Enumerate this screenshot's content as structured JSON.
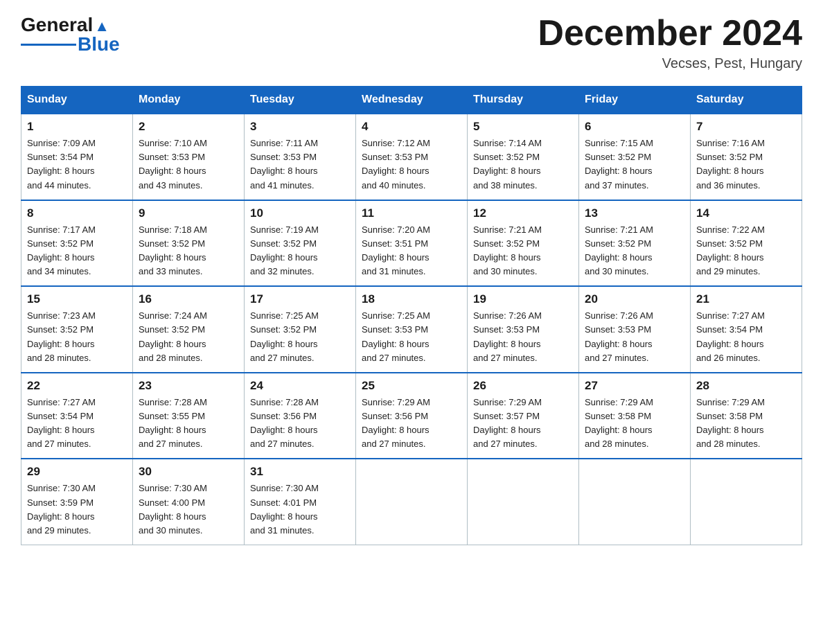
{
  "header": {
    "logo_general": "General",
    "logo_blue": "Blue",
    "month_title": "December 2024",
    "location": "Vecses, Pest, Hungary"
  },
  "weekdays": [
    "Sunday",
    "Monday",
    "Tuesday",
    "Wednesday",
    "Thursday",
    "Friday",
    "Saturday"
  ],
  "weeks": [
    [
      {
        "day": "1",
        "sunrise": "7:09 AM",
        "sunset": "3:54 PM",
        "daylight": "8 hours and 44 minutes."
      },
      {
        "day": "2",
        "sunrise": "7:10 AM",
        "sunset": "3:53 PM",
        "daylight": "8 hours and 43 minutes."
      },
      {
        "day": "3",
        "sunrise": "7:11 AM",
        "sunset": "3:53 PM",
        "daylight": "8 hours and 41 minutes."
      },
      {
        "day": "4",
        "sunrise": "7:12 AM",
        "sunset": "3:53 PM",
        "daylight": "8 hours and 40 minutes."
      },
      {
        "day": "5",
        "sunrise": "7:14 AM",
        "sunset": "3:52 PM",
        "daylight": "8 hours and 38 minutes."
      },
      {
        "day": "6",
        "sunrise": "7:15 AM",
        "sunset": "3:52 PM",
        "daylight": "8 hours and 37 minutes."
      },
      {
        "day": "7",
        "sunrise": "7:16 AM",
        "sunset": "3:52 PM",
        "daylight": "8 hours and 36 minutes."
      }
    ],
    [
      {
        "day": "8",
        "sunrise": "7:17 AM",
        "sunset": "3:52 PM",
        "daylight": "8 hours and 34 minutes."
      },
      {
        "day": "9",
        "sunrise": "7:18 AM",
        "sunset": "3:52 PM",
        "daylight": "8 hours and 33 minutes."
      },
      {
        "day": "10",
        "sunrise": "7:19 AM",
        "sunset": "3:52 PM",
        "daylight": "8 hours and 32 minutes."
      },
      {
        "day": "11",
        "sunrise": "7:20 AM",
        "sunset": "3:51 PM",
        "daylight": "8 hours and 31 minutes."
      },
      {
        "day": "12",
        "sunrise": "7:21 AM",
        "sunset": "3:52 PM",
        "daylight": "8 hours and 30 minutes."
      },
      {
        "day": "13",
        "sunrise": "7:21 AM",
        "sunset": "3:52 PM",
        "daylight": "8 hours and 30 minutes."
      },
      {
        "day": "14",
        "sunrise": "7:22 AM",
        "sunset": "3:52 PM",
        "daylight": "8 hours and 29 minutes."
      }
    ],
    [
      {
        "day": "15",
        "sunrise": "7:23 AM",
        "sunset": "3:52 PM",
        "daylight": "8 hours and 28 minutes."
      },
      {
        "day": "16",
        "sunrise": "7:24 AM",
        "sunset": "3:52 PM",
        "daylight": "8 hours and 28 minutes."
      },
      {
        "day": "17",
        "sunrise": "7:25 AM",
        "sunset": "3:52 PM",
        "daylight": "8 hours and 27 minutes."
      },
      {
        "day": "18",
        "sunrise": "7:25 AM",
        "sunset": "3:53 PM",
        "daylight": "8 hours and 27 minutes."
      },
      {
        "day": "19",
        "sunrise": "7:26 AM",
        "sunset": "3:53 PM",
        "daylight": "8 hours and 27 minutes."
      },
      {
        "day": "20",
        "sunrise": "7:26 AM",
        "sunset": "3:53 PM",
        "daylight": "8 hours and 27 minutes."
      },
      {
        "day": "21",
        "sunrise": "7:27 AM",
        "sunset": "3:54 PM",
        "daylight": "8 hours and 26 minutes."
      }
    ],
    [
      {
        "day": "22",
        "sunrise": "7:27 AM",
        "sunset": "3:54 PM",
        "daylight": "8 hours and 27 minutes."
      },
      {
        "day": "23",
        "sunrise": "7:28 AM",
        "sunset": "3:55 PM",
        "daylight": "8 hours and 27 minutes."
      },
      {
        "day": "24",
        "sunrise": "7:28 AM",
        "sunset": "3:56 PM",
        "daylight": "8 hours and 27 minutes."
      },
      {
        "day": "25",
        "sunrise": "7:29 AM",
        "sunset": "3:56 PM",
        "daylight": "8 hours and 27 minutes."
      },
      {
        "day": "26",
        "sunrise": "7:29 AM",
        "sunset": "3:57 PM",
        "daylight": "8 hours and 27 minutes."
      },
      {
        "day": "27",
        "sunrise": "7:29 AM",
        "sunset": "3:58 PM",
        "daylight": "8 hours and 28 minutes."
      },
      {
        "day": "28",
        "sunrise": "7:29 AM",
        "sunset": "3:58 PM",
        "daylight": "8 hours and 28 minutes."
      }
    ],
    [
      {
        "day": "29",
        "sunrise": "7:30 AM",
        "sunset": "3:59 PM",
        "daylight": "8 hours and 29 minutes."
      },
      {
        "day": "30",
        "sunrise": "7:30 AM",
        "sunset": "4:00 PM",
        "daylight": "8 hours and 30 minutes."
      },
      {
        "day": "31",
        "sunrise": "7:30 AM",
        "sunset": "4:01 PM",
        "daylight": "8 hours and 31 minutes."
      },
      null,
      null,
      null,
      null
    ]
  ],
  "labels": {
    "sunrise": "Sunrise:",
    "sunset": "Sunset:",
    "daylight": "Daylight:"
  }
}
